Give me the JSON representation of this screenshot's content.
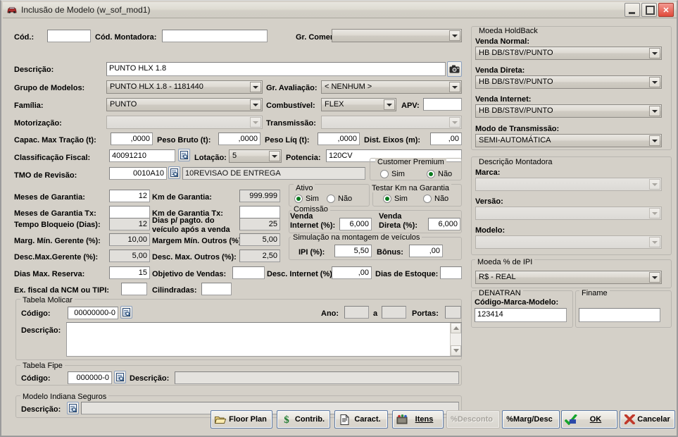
{
  "window": {
    "title": "Inclusão de Modelo (w_sof_mod1)",
    "icon": "car-icon",
    "minimize": "minimize-icon",
    "maximize": "maximize-icon",
    "close": "close-icon"
  },
  "form": {
    "cod_label": "Cód.:",
    "cod_value": "",
    "cod_montadora_label": "Cód. Montadora:",
    "cod_montadora_value": "",
    "gr_comercial_label": "Gr. Comercial:",
    "gr_comercial_value": "",
    "descricao_label": "Descrição:",
    "descricao_value": "PUNTO HLX 1.8",
    "camera_icon": "camera-icon",
    "grupo_modelos_label": "Grupo de Modelos:",
    "grupo_modelos_value": "PUNTO HLX 1.8 - 1181440",
    "gr_avaliacao_label": "Gr. Avaliação:",
    "gr_avaliacao_value": "< NENHUM >",
    "familia_label": "Família:",
    "familia_value": "PUNTO",
    "combustivel_label": "Combustível:",
    "combustivel_value": "FLEX",
    "apv_label": "APV:",
    "apv_value": "",
    "motorizacao_label": "Motorização:",
    "motorizacao_value": "",
    "transmissao_label": "Transmissão:",
    "transmissao_value": "",
    "capac_max_tracao_label": "Capac. Max Tração (t):",
    "capac_max_tracao_value": ",0000",
    "peso_bruto_label": "Peso Bruto (t):",
    "peso_bruto_value": ",0000",
    "peso_liq_label": "Peso Líq (t):",
    "peso_liq_value": ",0000",
    "dist_eixos_label": "Dist. Eixos (m):",
    "dist_eixos_value": ",00",
    "classificacao_fiscal_label": "Classificação Fiscal:",
    "classificacao_fiscal_value": "40091210",
    "lotacao_label": "Lotação:",
    "lotacao_value": "5",
    "potencia_label": "Potencia:",
    "potencia_value": "120CV",
    "tmo_revisao_label": "TMO de Revisão:",
    "tmo_revisao_code": "0010A10",
    "tmo_revisao_desc": "10REVISAO DE ENTREGA",
    "meses_garantia_label": "Meses de Garantia:",
    "meses_garantia_value": "12",
    "km_garantia_label": "Km de Garantia:",
    "km_garantia_value": "999.999",
    "meses_garantia_tx_label": "Meses de Garantia Tx:",
    "meses_garantia_tx_value": "",
    "km_garantia_tx_label": "Km de Garantia Tx:",
    "km_garantia_tx_value": "",
    "tempo_bloqueio_label": "Tempo Bloqueio (Dias):",
    "tempo_bloqueio_value": "12",
    "dias_pagto_label_1": "Dias p/ pagto. do",
    "dias_pagto_label_2": "veículo após a venda",
    "dias_pagto_value": "25",
    "marg_min_gerente_label": "Marg. Mín. Gerente (%):",
    "marg_min_gerente_value": "10,00",
    "margem_min_outros_label": "Margem Mín. Outros (%):",
    "margem_min_outros_value": "5,00",
    "desc_max_gerente_label": "Desc.Max.Gerente (%):",
    "desc_max_gerente_value": "5,00",
    "desc_max_outros_label": "Desc. Max. Outros (%):",
    "desc_max_outros_value": "2,50",
    "dias_max_reserva_label": "Dias Max. Reserva:",
    "dias_max_reserva_value": "15",
    "objetivo_vendas_label": "Objetivo de Vendas:",
    "objetivo_vendas_value": "",
    "desc_internet_label": "Desc. Internet (%):",
    "desc_internet_value": ",00",
    "dias_estoque_label": "Dias de Estoque:",
    "dias_estoque_value": "",
    "ex_fiscal_label": "Ex. fiscal da NCM ou TIPI:",
    "ex_fiscal_value": "",
    "cilindradas_label": "Cilindradas:",
    "cilindradas_value": ""
  },
  "customer_premium": {
    "title": "Customer Premium",
    "sim": "Sim",
    "nao": "Não",
    "selected": "Não"
  },
  "ativo": {
    "title": "Ativo",
    "sim": "Sim",
    "nao": "Não",
    "selected": "Sim"
  },
  "testar_km": {
    "title": "Testar Km na Garantia",
    "sim": "Sim",
    "nao": "Não",
    "selected": "Sim"
  },
  "comissao": {
    "title": "Comissão",
    "venda_internet_label_1": "Venda",
    "venda_internet_label_2": "Internet (%):",
    "venda_internet_value": "6,000",
    "venda_direta_label_1": "Venda",
    "venda_direta_label_2": "Direta (%):",
    "venda_direta_value": "6,000"
  },
  "simulacao": {
    "title": "Simulação na montagem de veículos",
    "ipi_label": "IPI (%):",
    "ipi_value": "5,50",
    "bonus_label": "Bônus:",
    "bonus_value": ",00"
  },
  "tabela_molicar": {
    "title": "Tabela Molicar",
    "codigo_label": "Código:",
    "codigo_value": "00000000-0",
    "lookup_icon": "lookup-icon",
    "ano_label": "Ano:",
    "ano_de": "",
    "ano_a_label": "a",
    "ano_ate": "",
    "portas_label": "Portas:",
    "portas_value": "",
    "descricao_label": "Descrição:",
    "descricao_value": ""
  },
  "tabela_fipe": {
    "title": "Tabela Fipe",
    "codigo_label": "Código:",
    "codigo_value": "000000-0",
    "lookup_icon": "lookup-icon",
    "descricao_label": "Descrição:",
    "descricao_value": ""
  },
  "modelo_indiana": {
    "title": "Modelo Indiana Seguros",
    "descricao_label": "Descrição:",
    "lookup_icon": "lookup-icon",
    "descricao_value": ""
  },
  "moeda_holdback": {
    "title": "Moeda HoldBack",
    "venda_normal_label": "Venda Normal:",
    "venda_normal_value": "HB DB/ST8V/PUNTO",
    "venda_direta_label": "Venda Direta:",
    "venda_direta_value": "HB DB/ST8V/PUNTO",
    "venda_internet_label": "Venda Internet:",
    "venda_internet_value": "HB DB/ST8V/PUNTO",
    "modo_transmissao_label": "Modo de Transmissão:",
    "modo_transmissao_value": "SEMI-AUTOMÁTICA"
  },
  "descricao_montadora": {
    "title": "Descrição Montadora",
    "marca_label": "Marca:",
    "marca_value": "",
    "versao_label": "Versão:",
    "versao_value": "",
    "modelo_label": "Modelo:",
    "modelo_value": ""
  },
  "moeda_ipi": {
    "title": "Moeda % de IPI",
    "value": "R$   - REAL"
  },
  "denatran": {
    "title": "DENATRAN",
    "codigo_label": "Código-Marca-Modelo:",
    "codigo_value": "123414"
  },
  "finame": {
    "title": "Finame",
    "value": ""
  },
  "buttons": {
    "floor_plan": "Floor Plan",
    "contrib": "Contrib.",
    "caract": "Caract.",
    "itens": "Itens",
    "desconto": "%Desconto",
    "marg_desc": "%Marg/Desc",
    "ok": "OK",
    "cancelar": "Cancelar"
  },
  "colors": {
    "window_bg": "#d4d0c8",
    "field_bg": "#ffffff",
    "readonly_bg": "#e4e2de",
    "radio_dot": "#0a7a1e",
    "button_border": "#5f7ba5",
    "close_button": "#e04a3a"
  }
}
